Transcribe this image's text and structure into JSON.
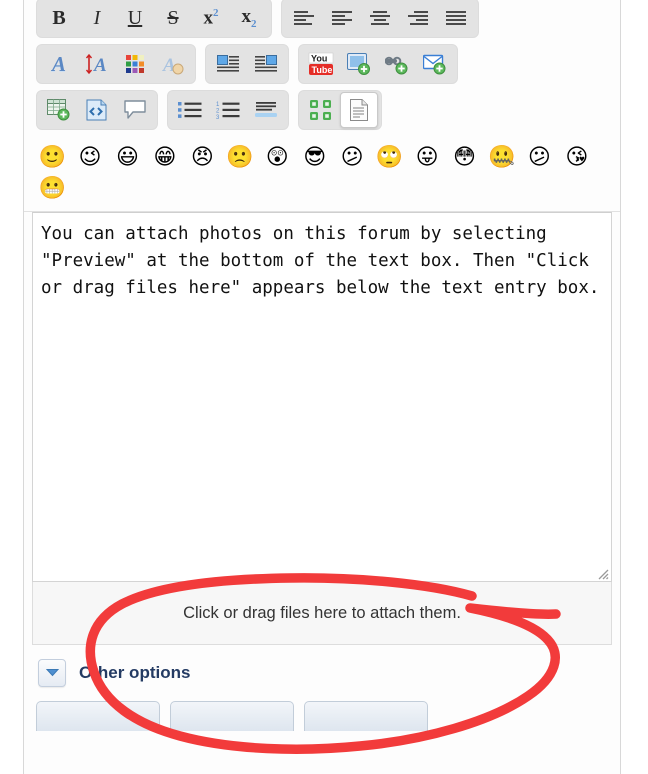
{
  "editor": {
    "toolbar_rows": [
      {
        "groups": [
          {
            "name": "text-format-group",
            "buttons": [
              {
                "name": "bold-icon",
                "label": "B",
                "title": "Bold"
              },
              {
                "name": "italic-icon",
                "label": "I",
                "title": "Italic"
              },
              {
                "name": "underline-icon",
                "label": "U",
                "title": "Underline"
              },
              {
                "name": "strikethrough-icon",
                "label": "S",
                "title": "Strikethrough"
              },
              {
                "name": "superscript-icon",
                "label": "x2",
                "title": "Superscript"
              },
              {
                "name": "subscript-icon",
                "label": "x2",
                "title": "Subscript"
              }
            ]
          },
          {
            "name": "alignment-group",
            "buttons": [
              {
                "name": "align-left-icon",
                "label": "",
                "title": "Align left"
              },
              {
                "name": "align-left-alt-icon",
                "label": "",
                "title": "Align left"
              },
              {
                "name": "align-center-icon",
                "label": "",
                "title": "Align center"
              },
              {
                "name": "align-right-icon",
                "label": "",
                "title": "Align right"
              },
              {
                "name": "align-justify-icon",
                "label": "",
                "title": "Justify"
              }
            ]
          }
        ]
      },
      {
        "groups": [
          {
            "name": "font-group",
            "buttons": [
              {
                "name": "font-family-icon",
                "label": "A",
                "title": "Font family"
              },
              {
                "name": "font-size-icon",
                "label": "A",
                "title": "Font size"
              },
              {
                "name": "font-color-icon",
                "label": "",
                "title": "Font colour"
              },
              {
                "name": "remove-formatting-icon",
                "label": "A",
                "title": "Remove formatting"
              }
            ]
          },
          {
            "name": "float-group",
            "buttons": [
              {
                "name": "float-left-icon",
                "label": "",
                "title": "Float left"
              },
              {
                "name": "float-right-icon",
                "label": "",
                "title": "Float right"
              }
            ]
          },
          {
            "name": "insert-media-group",
            "buttons": [
              {
                "name": "youtube-icon",
                "label": "You Tube",
                "title": "Insert YouTube video"
              },
              {
                "name": "insert-image-icon",
                "label": "",
                "title": "Insert image"
              },
              {
                "name": "insert-link-icon",
                "label": "",
                "title": "Insert link"
              },
              {
                "name": "insert-email-icon",
                "label": "",
                "title": "Insert email"
              }
            ]
          }
        ]
      },
      {
        "groups": [
          {
            "name": "insert-block-group",
            "buttons": [
              {
                "name": "insert-table-icon",
                "label": "",
                "title": "Insert table"
              },
              {
                "name": "insert-code-icon",
                "label": "",
                "title": "Insert code"
              },
              {
                "name": "insert-quote-icon",
                "label": "",
                "title": "Insert quote"
              }
            ]
          },
          {
            "name": "list-group",
            "buttons": [
              {
                "name": "bullet-list-icon",
                "label": "",
                "title": "Bullet list"
              },
              {
                "name": "numbered-list-icon",
                "label": "",
                "title": "Numbered list"
              },
              {
                "name": "horizontal-rule-icon",
                "label": "",
                "title": "Horizontal rule"
              }
            ]
          },
          {
            "name": "view-group",
            "buttons": [
              {
                "name": "maximize-icon",
                "label": "",
                "title": "Maximize"
              },
              {
                "name": "source-view-icon",
                "label": "",
                "title": "View source",
                "pressed": true
              }
            ]
          }
        ]
      }
    ],
    "emoji_rows": [
      [
        {
          "name": "emoji-smile",
          "glyph": "🙂"
        },
        {
          "name": "emoji-wink",
          "glyph": "😉"
        },
        {
          "name": "emoji-cheesy",
          "glyph": "😃"
        },
        {
          "name": "emoji-grin",
          "glyph": "😁"
        },
        {
          "name": "emoji-angry",
          "glyph": "😠"
        },
        {
          "name": "emoji-sad",
          "glyph": "🙁"
        },
        {
          "name": "emoji-shocked",
          "glyph": "😲"
        },
        {
          "name": "emoji-cool",
          "glyph": "😎"
        },
        {
          "name": "emoji-huh",
          "glyph": "😕"
        },
        {
          "name": "emoji-rolleyes",
          "glyph": "🙄"
        },
        {
          "name": "emoji-tongue",
          "glyph": "😛"
        },
        {
          "name": "emoji-embarrassed",
          "glyph": "😳"
        },
        {
          "name": "emoji-lipssealed",
          "glyph": "🤐"
        },
        {
          "name": "emoji-undecided",
          "glyph": "😕"
        },
        {
          "name": "emoji-kiss",
          "glyph": "😘"
        }
      ],
      [
        {
          "name": "emoji-cry",
          "glyph": "😬"
        }
      ]
    ],
    "textarea": {
      "value": "You can attach photos on this forum by selecting \"Preview\" at the bottom of the text box. Then \"Click or drag files here\" appears below the text entry box.",
      "placeholder": ""
    },
    "attach_zone": {
      "label": "Click or drag files here to attach them."
    },
    "other_options": {
      "label": "Other options",
      "toggle_icon": "chevron-down-icon"
    },
    "bottom_buttons": [
      {
        "name": "action-button-1",
        "label": ""
      },
      {
        "name": "action-button-2",
        "label": ""
      },
      {
        "name": "action-button-3",
        "label": ""
      }
    ]
  },
  "annotation": {
    "type": "hand-drawn-ellipse",
    "color": "#f23b3b",
    "stroke_width": 9,
    "target": "attach-zone"
  },
  "colors": {
    "toolbar_group_bg": "#e3e3e3",
    "page_bg": "#ffffff",
    "attach_zone_bg": "#f7f7f7",
    "other_options_text": "#243b63",
    "annotation_red": "#f23b3b"
  }
}
